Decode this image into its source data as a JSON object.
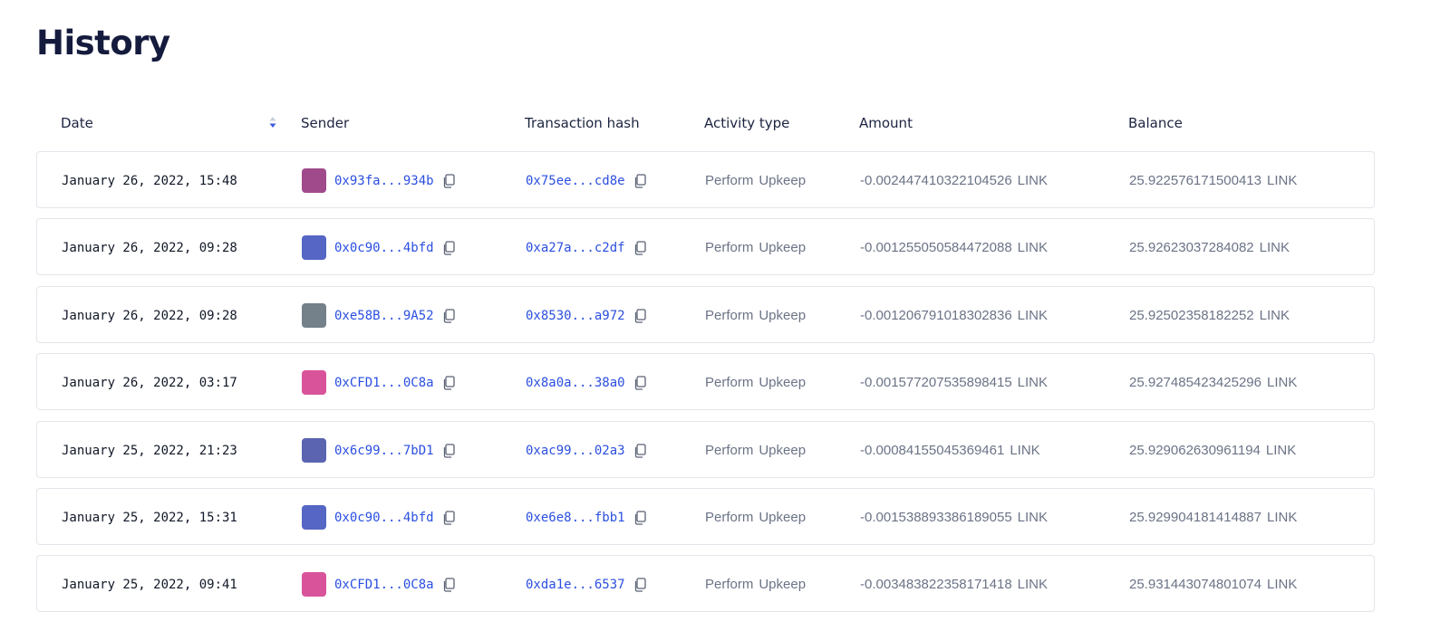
{
  "page": {
    "title": "History"
  },
  "table": {
    "columns": {
      "date": "Date",
      "sender": "Sender",
      "hash": "Transaction hash",
      "activity": "Activity type",
      "amount": "Amount",
      "balance": "Balance"
    },
    "sort": {
      "column": "date",
      "icon": "sort-icon"
    },
    "rows": [
      {
        "date": "January 26, 2022, 15:48",
        "sender": "0x93fa...934b",
        "sender_avatar_color": "#a04a8c",
        "hash": "0x75ee...cd8e",
        "activity_1": "Perform",
        "activity_2": "Upkeep",
        "amount": "-0.002447410322104526",
        "amount_unit": "LINK",
        "balance": "25.922576171500413",
        "balance_unit": "LINK"
      },
      {
        "date": "January 26, 2022, 09:28",
        "sender": "0x0c90...4bfd",
        "sender_avatar_color": "#5566c4",
        "hash": "0xa27a...c2df",
        "activity_1": "Perform",
        "activity_2": "Upkeep",
        "amount": "-0.001255050584472088",
        "amount_unit": "LINK",
        "balance": "25.92623037284082",
        "balance_unit": "LINK"
      },
      {
        "date": "January 26, 2022, 09:28",
        "sender": "0xe58B...9A52",
        "sender_avatar_color": "#74808a",
        "hash": "0x8530...a972",
        "activity_1": "Perform",
        "activity_2": "Upkeep",
        "amount": "-0.001206791018302836",
        "amount_unit": "LINK",
        "balance": "25.92502358182252",
        "balance_unit": "LINK"
      },
      {
        "date": "January 26, 2022, 03:17",
        "sender": "0xCFD1...0C8a",
        "sender_avatar_color": "#d9539a",
        "hash": "0x8a0a...38a0",
        "activity_1": "Perform",
        "activity_2": "Upkeep",
        "amount": "-0.001577207535898415",
        "amount_unit": "LINK",
        "balance": "25.927485423425296",
        "balance_unit": "LINK"
      },
      {
        "date": "January 25, 2022, 21:23",
        "sender": "0x6c99...7bD1",
        "sender_avatar_color": "#5a64b0",
        "hash": "0xac99...02a3",
        "activity_1": "Perform",
        "activity_2": "Upkeep",
        "amount": "-0.00084155045369461",
        "amount_unit": "LINK",
        "balance": "25.929062630961194",
        "balance_unit": "LINK"
      },
      {
        "date": "January 25, 2022, 15:31",
        "sender": "0x0c90...4bfd",
        "sender_avatar_color": "#5566c4",
        "hash": "0xe6e8...fbb1",
        "activity_1": "Perform",
        "activity_2": "Upkeep",
        "amount": "-0.001538893386189055",
        "amount_unit": "LINK",
        "balance": "25.929904181414887",
        "balance_unit": "LINK"
      },
      {
        "date": "January 25, 2022, 09:41",
        "sender": "0xCFD1...0C8a",
        "sender_avatar_color": "#d9539a",
        "hash": "0xda1e...6537",
        "activity_1": "Perform",
        "activity_2": "Upkeep",
        "amount": "-0.003483822358171418",
        "amount_unit": "LINK",
        "balance": "25.931443074801074",
        "balance_unit": "LINK"
      }
    ]
  },
  "icons": {
    "copy": "copy-icon",
    "sort": "sort-icon"
  },
  "colors": {
    "link": "#2b4fe0",
    "muted": "#6b7386",
    "heading": "#141b3d",
    "border": "#e2e5ea",
    "sort_active": "#3b5bdb"
  }
}
